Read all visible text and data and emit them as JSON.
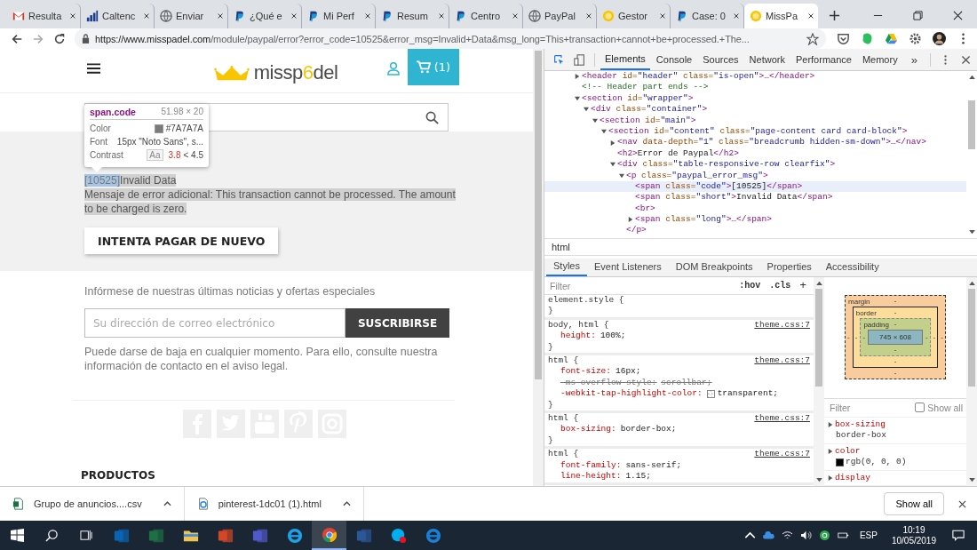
{
  "browser_tabs": [
    {
      "title": "Resulta",
      "kind": "gmail",
      "selected": false
    },
    {
      "title": "Caltenc",
      "kind": "chart",
      "selected": false
    },
    {
      "title": "Enviar",
      "kind": "globe",
      "selected": false
    },
    {
      "title": "¿Qué e",
      "kind": "paypal",
      "selected": false
    },
    {
      "title": "Mi Perf",
      "kind": "paypal",
      "selected": false
    },
    {
      "title": "Resum",
      "kind": "paypal",
      "selected": false
    },
    {
      "title": "Centro",
      "kind": "paypal",
      "selected": false
    },
    {
      "title": "PayPal",
      "kind": "globe",
      "selected": false
    },
    {
      "title": "Gestor",
      "kind": "smiley",
      "selected": false
    },
    {
      "title": "Case: 0",
      "kind": "paypal",
      "selected": false
    },
    {
      "title": "MissPa",
      "kind": "smiley",
      "selected": true
    }
  ],
  "address_bar": {
    "host": "https://www.misspadel.com",
    "path": "/module/paypal/error?error_code=10525&error_msg=Invalid+Data&msg_long=This+transaction+cannot+be+processed.+The..."
  },
  "page": {
    "logo": {
      "start": "missp",
      "accent": "6",
      "end": "del"
    },
    "cart_count": "(1)",
    "inspect_tooltip": {
      "selector": "span.code",
      "size": "51.98 × 20",
      "rows": [
        {
          "kind": "color",
          "label": "Color",
          "value": "#7A7A7A"
        },
        {
          "kind": "text",
          "label": "Font",
          "value": "15px \"Noto Sans\", s..."
        },
        {
          "kind": "contrast",
          "label": "Contrast",
          "badge": "Aa",
          "ratio": "3.8",
          "threshold": "< 4.5"
        }
      ]
    },
    "error": {
      "code": "[10525]",
      "short": "Invalid Data",
      "long": "Mensaje de error adicional: This transaction cannot be processed. The amount to be charged is zero."
    },
    "retry_button": "INTENTA PAGAR DE NUEVO",
    "newsletter": {
      "heading": "Infórmese de nuestras últimas noticias y ofertas especiales",
      "placeholder": "Su dirección de correo electrónico",
      "button": "SUSCRIBIRSE",
      "note": "Puede darse de baja en cualquier momento. Para ello, consulte nuestra información de contacto en el aviso legal."
    },
    "footer_heading": "PRODUCTOS"
  },
  "devtools": {
    "tabs": [
      {
        "label": "Elements",
        "selected": true
      },
      {
        "label": "Console",
        "selected": false
      },
      {
        "label": "Sources",
        "selected": false
      },
      {
        "label": "Network",
        "selected": false
      },
      {
        "label": "Performance",
        "selected": false
      },
      {
        "label": "Memory",
        "selected": false
      }
    ],
    "overflow": "»",
    "dom_tree": [
      {
        "text": "<header id=\"header\" class=\"is-open\">…</header>",
        "expanded": false,
        "selected": false
      },
      {
        "text": "<!-- Header part ends -->",
        "selected": false
      },
      {
        "text": "<section id=\"wrapper\">",
        "expanded": true,
        "selected": false,
        "children": [
          {
            "text": "<div class=\"container\">",
            "expanded": true,
            "selected": false,
            "children": [
              {
                "text": "<section id=\"main\">",
                "expanded": true,
                "selected": false,
                "children": [
                  {
                    "text": "<section id=\"content\" class=\"page-content card card-block\">",
                    "expanded": true,
                    "selected": false,
                    "children": [
                      {
                        "text": "<nav data-depth=\"1\" class=\"breadcrumb hidden-sm-down\">…</nav>",
                        "expanded": false,
                        "selected": false
                      },
                      {
                        "text": "<h2>Error de Paypal</h2>",
                        "selected": false
                      },
                      {
                        "text": "<div class=\"table-responsive-row clearfix\">",
                        "expanded": true,
                        "selected": false,
                        "children": [
                          {
                            "text": "<p class=\"paypal_error_msg\">",
                            "expanded": true,
                            "selected": false,
                            "close": "</p>",
                            "children": [
                              {
                                "text": "<span class=\"code\">[10525]</span>",
                                "selected": true
                              },
                              {
                                "text": "<span class=\"short\">Invalid Data</span>",
                                "selected": false
                              },
                              {
                                "text": "<br>",
                                "selected": false
                              },
                              {
                                "text": "<span class=\"long\">…</span>",
                                "expanded": false,
                                "selected": false
                              }
                            ]
                          }
                        ]
                      }
                    ]
                  }
                ]
              }
            ]
          }
        ]
      }
    ],
    "breadcrumb": "html",
    "pane_tabs": [
      {
        "label": "Styles",
        "selected": true
      },
      {
        "label": "Event Listeners",
        "selected": false
      },
      {
        "label": "DOM Breakpoints",
        "selected": false
      },
      {
        "label": "Properties",
        "selected": false
      },
      {
        "label": "Accessibility",
        "selected": false
      }
    ],
    "styles": {
      "filter_placeholder": "Filter",
      "hov": ":hov",
      "cls": ".cls",
      "add": "+",
      "rules": [
        {
          "selector": "element.style {",
          "close": "}"
        },
        {
          "selector": "body, html {",
          "source": "theme.css:7",
          "close": "}",
          "declarations": [
            {
              "kind": "plain",
              "prop": "height:",
              "value": "100%;",
              "struck": false
            }
          ]
        },
        {
          "selector": "html {",
          "source": "theme.css:7",
          "close": "}",
          "declarations": [
            {
              "kind": "plain",
              "prop": "font-size:",
              "value": "16px;",
              "struck": false
            },
            {
              "kind": "plain",
              "prop": "-ms-overflow-style:",
              "value": "scrollbar;",
              "struck": true
            },
            {
              "kind": "color",
              "prop": "-webkit-tap-highlight-color:",
              "value": "transparent;",
              "struck": false
            }
          ]
        },
        {
          "selector": "html {",
          "source": "theme.css:7",
          "close": "}",
          "declarations": [
            {
              "kind": "plain",
              "prop": "box-sizing:",
              "value": "border-box;",
              "struck": false
            }
          ]
        },
        {
          "selector": "html {",
          "source": "theme.css:7",
          "declarations": [
            {
              "kind": "plain",
              "prop": "font-family:",
              "value": "sans-serif;",
              "struck": false
            },
            {
              "kind": "plain",
              "prop": "line-height:",
              "value": "1.15;",
              "struck": false
            }
          ]
        }
      ]
    },
    "box_model": {
      "margin": {
        "label": "margin",
        "top": "-",
        "right": "-",
        "bottom": "-",
        "left": "-"
      },
      "border": {
        "label": "border",
        "top": "-",
        "right": "-",
        "bottom": "-",
        "left": "-"
      },
      "padding": {
        "label": "padding",
        "top": "-",
        "right": "-",
        "bottom": "-",
        "left": "-"
      },
      "content": "745 × 608"
    },
    "computed": {
      "filter_placeholder": "Filter",
      "show_all": {
        "label": "Show all",
        "checked": false
      },
      "properties": [
        {
          "kind": "plain",
          "prop": "box-sizing",
          "value": "border-box"
        },
        {
          "kind": "color",
          "prop": "color",
          "value": "rgb(0, 0, 0)"
        },
        {
          "prop": "display"
        }
      ]
    }
  },
  "downloads": {
    "items": [
      {
        "name": "Grupo de anuncios....csv",
        "kind": "csv"
      },
      {
        "name": "pinterest-1dc01 (1).html",
        "kind": "html"
      }
    ],
    "show_all": "Show all"
  },
  "taskbar": {
    "apps": [
      {
        "kind": "outlook",
        "selected": false
      },
      {
        "kind": "excel",
        "selected": false
      },
      {
        "kind": "folder",
        "selected": false
      },
      {
        "kind": "powerpoint",
        "selected": false
      },
      {
        "kind": "teams",
        "selected": false
      },
      {
        "kind": "ie",
        "selected": false
      },
      {
        "kind": "chrome",
        "selected": true
      },
      {
        "kind": "word",
        "selected": false
      },
      {
        "kind": "skype",
        "selected": false
      },
      {
        "kind": "edge",
        "selected": false
      }
    ],
    "language": "ESP",
    "time": "10:19",
    "date": "10/05/2019"
  }
}
